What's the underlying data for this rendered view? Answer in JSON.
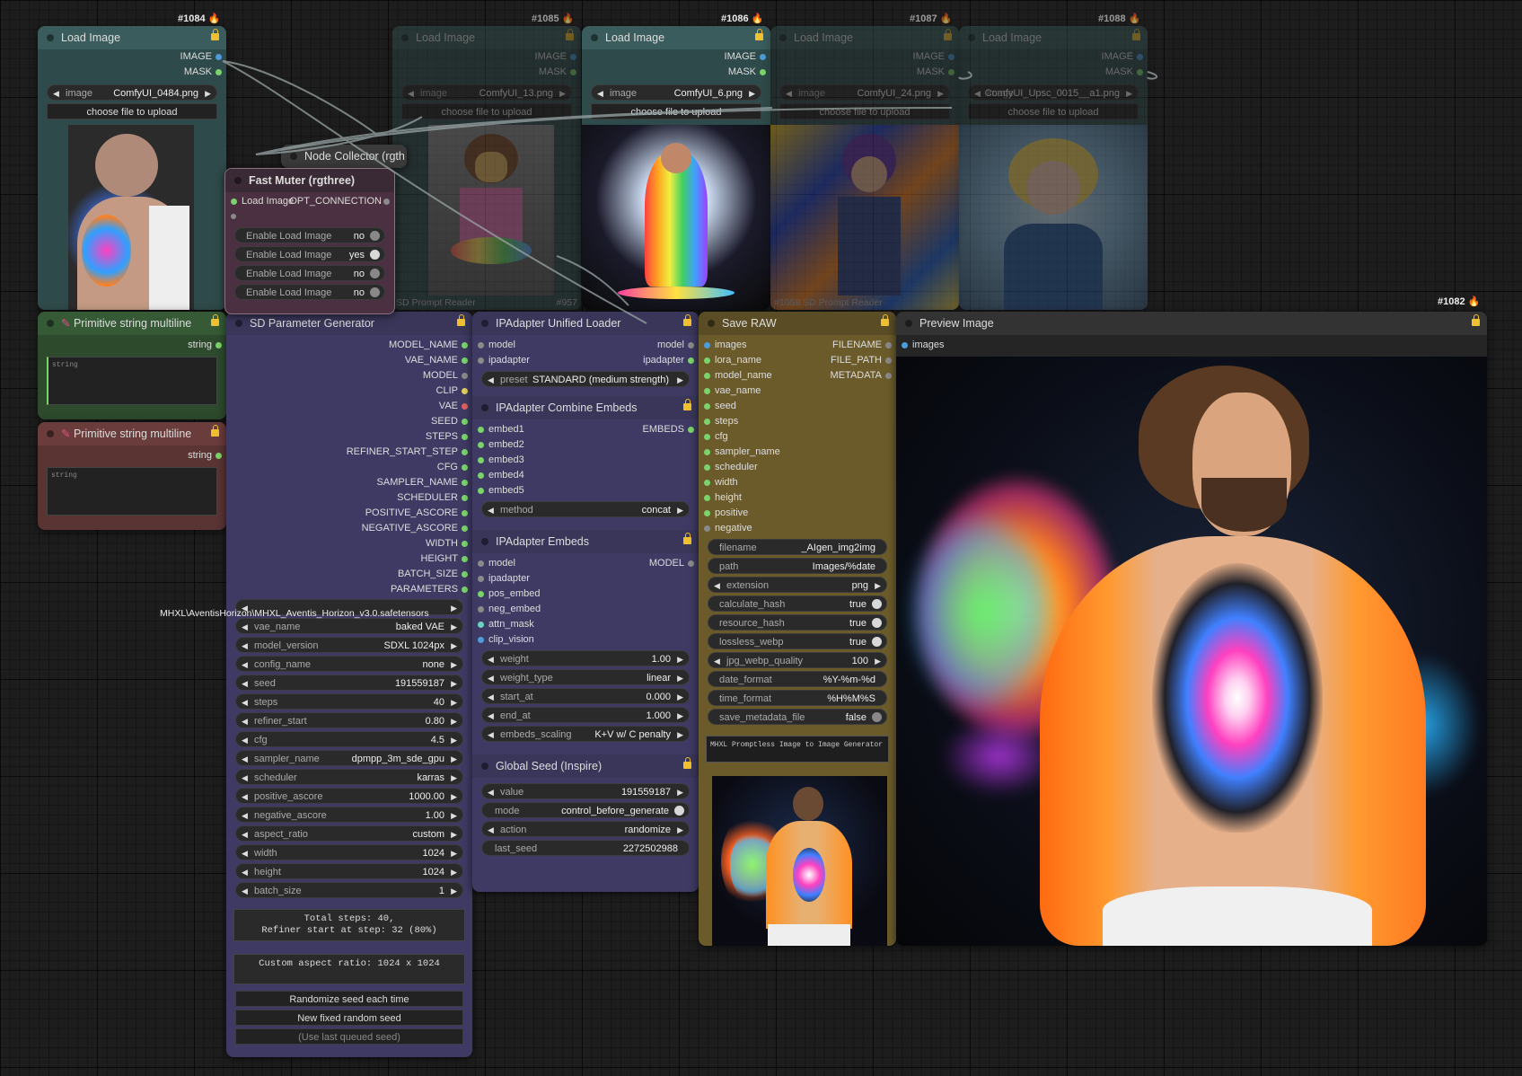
{
  "colors": {
    "canvas": "#1d1d1d",
    "load_image_node": "#2f4a4a",
    "primitive_green": "#2d4a2d",
    "primitive_red": "#5a3333",
    "purple_node": "#3e3a63",
    "save_raw_node": "#6b5b2b",
    "fire_badge": "#ff8c2a",
    "lock": "#f0c030",
    "green_slot": "#7bd36b"
  },
  "load_nodes": [
    {
      "id": "#1084",
      "title": "Load Image",
      "out1": "IMAGE",
      "out2": "MASK",
      "image_label": "image",
      "image_value": "ComfyUI_0484.png",
      "upload": "choose file to upload"
    },
    {
      "id": "#1085",
      "title": "Load Image",
      "out1": "IMAGE",
      "out2": "MASK",
      "image_label": "image",
      "image_value": "ComfyUI_13.png",
      "upload": "choose file to upload",
      "footer_left": "SD Prompt Reader",
      "footer_right": "#957"
    },
    {
      "id": "#1086",
      "title": "Load Image",
      "out1": "IMAGE",
      "out2": "MASK",
      "image_label": "image",
      "image_value": "ComfyUI_6.png",
      "upload": "choose file to upload"
    },
    {
      "id": "#1087",
      "title": "Load Image",
      "out1": "IMAGE",
      "out2": "MASK",
      "image_label": "image",
      "image_value": "ComfyUI_24.png",
      "upload": "choose file to upload",
      "footer_left": "#1058 SD Prompt Reader"
    },
    {
      "id": "#1088",
      "title": "Load Image",
      "out1": "IMAGE",
      "out2": "MASK",
      "image_label": "image",
      "image_value": "ComfyUI_Upsc_0015__a1.png",
      "upload": "choose file to upload"
    }
  ],
  "node_collector": {
    "title": "Node Collector (rgth"
  },
  "fast_muter": {
    "title": "Fast Muter (rgthree)",
    "input": "Load Image",
    "output": "OPT_CONNECTION",
    "toggles": [
      {
        "label": "Enable Load Image",
        "value": "no"
      },
      {
        "label": "Enable Load Image",
        "value": "yes"
      },
      {
        "label": "Enable Load Image",
        "value": "no"
      },
      {
        "label": "Enable Load Image",
        "value": "no"
      }
    ]
  },
  "primitive1": {
    "title": "Primitive string multiline",
    "output": "string",
    "placeholder": "string"
  },
  "primitive2": {
    "title": "Primitive string multiline",
    "output": "string",
    "placeholder": "string"
  },
  "sd_param": {
    "title": "SD Parameter Generator",
    "outputs": [
      "MODEL_NAME",
      "VAE_NAME",
      "MODEL",
      "CLIP",
      "VAE",
      "SEED",
      "STEPS",
      "REFINER_START_STEP",
      "CFG",
      "SAMPLER_NAME",
      "SCHEDULER",
      "POSITIVE_ASCORE",
      "NEGATIVE_ASCORE",
      "WIDTH",
      "HEIGHT",
      "BATCH_SIZE",
      "PARAMETERS"
    ],
    "ckpt_overflow": "MHXL\\AventisHorizon\\MHXL_Aventis_Horizon_v3.0.safetensors",
    "widgets": [
      {
        "label": "vae_name",
        "value": "baked VAE"
      },
      {
        "label": "model_version",
        "value": "SDXL 1024px"
      },
      {
        "label": "config_name",
        "value": "none"
      },
      {
        "label": "seed",
        "value": "191559187"
      },
      {
        "label": "steps",
        "value": "40"
      },
      {
        "label": "refiner_start",
        "value": "0.80"
      },
      {
        "label": "cfg",
        "value": "4.5"
      },
      {
        "label": "sampler_name",
        "value": "dpmpp_3m_sde_gpu"
      },
      {
        "label": "scheduler",
        "value": "karras"
      },
      {
        "label": "positive_ascore",
        "value": "1000.00"
      },
      {
        "label": "negative_ascore",
        "value": "1.00"
      },
      {
        "label": "aspect_ratio",
        "value": "custom"
      },
      {
        "label": "width",
        "value": "1024"
      },
      {
        "label": "height",
        "value": "1024"
      },
      {
        "label": "batch_size",
        "value": "1"
      }
    ],
    "info1_line1": "Total steps: 40,",
    "info1_line2": "Refiner start at step: 32 (80%)",
    "info2": "Custom aspect ratio: 1024 x 1024",
    "btn_randomize": "Randomize seed each time",
    "btn_newseed": "New fixed random seed",
    "btn_lastseed": "(Use last queued seed)"
  },
  "ipa_loader": {
    "title": "IPAdapter Unified Loader",
    "in1": "model",
    "out1": "model",
    "in2": "ipadapter",
    "out2": "ipadapter",
    "preset_label": "preset",
    "preset_value": "STANDARD (medium strength)"
  },
  "ipa_combine": {
    "title": "IPAdapter Combine Embeds",
    "inputs": [
      "embed1",
      "embed2",
      "embed3",
      "embed4",
      "embed5"
    ],
    "output": "EMBEDS",
    "method_label": "method",
    "method_value": "concat"
  },
  "ipa_embeds": {
    "title": "IPAdapter Embeds",
    "inputs": [
      "model",
      "ipadapter",
      "pos_embed",
      "neg_embed",
      "attn_mask",
      "clip_vision"
    ],
    "output": "MODEL",
    "widgets": [
      {
        "label": "weight",
        "value": "1.00"
      },
      {
        "label": "weight_type",
        "value": "linear"
      },
      {
        "label": "start_at",
        "value": "0.000"
      },
      {
        "label": "end_at",
        "value": "1.000"
      },
      {
        "label": "embeds_scaling",
        "value": "K+V w/ C penalty"
      }
    ]
  },
  "global_seed": {
    "title": "Global Seed (Inspire)",
    "widgets": [
      {
        "label": "value",
        "value": "191559187"
      },
      {
        "label": "mode",
        "value": "control_before_generate"
      },
      {
        "label": "action",
        "value": "randomize"
      },
      {
        "label": "last_seed",
        "value": "2272502988"
      }
    ]
  },
  "save_raw": {
    "title": "Save RAW",
    "inputs": [
      "images",
      "lora_name",
      "model_name",
      "vae_name",
      "seed",
      "steps",
      "cfg",
      "sampler_name",
      "scheduler",
      "width",
      "height",
      "positive",
      "negative"
    ],
    "outputs": [
      "FILENAME",
      "FILE_PATH",
      "METADATA"
    ],
    "widgets": [
      {
        "label": "filename",
        "value": "_AIgen_img2img"
      },
      {
        "label": "path",
        "value": "Images/%date"
      },
      {
        "label": "extension",
        "value": "png"
      },
      {
        "label": "calculate_hash",
        "value": "true"
      },
      {
        "label": "resource_hash",
        "value": "true"
      },
      {
        "label": "lossless_webp",
        "value": "true"
      },
      {
        "label": "jpg_webp_quality",
        "value": "100"
      },
      {
        "label": "date_format",
        "value": "%Y-%m-%d"
      },
      {
        "label": "time_format",
        "value": "%H%M%S"
      },
      {
        "label": "save_metadata_file",
        "value": "false"
      }
    ],
    "label_text": "MHXL Promptless Image to Image Generator"
  },
  "preview": {
    "id": "#1082",
    "title": "Preview Image",
    "input": "images"
  }
}
